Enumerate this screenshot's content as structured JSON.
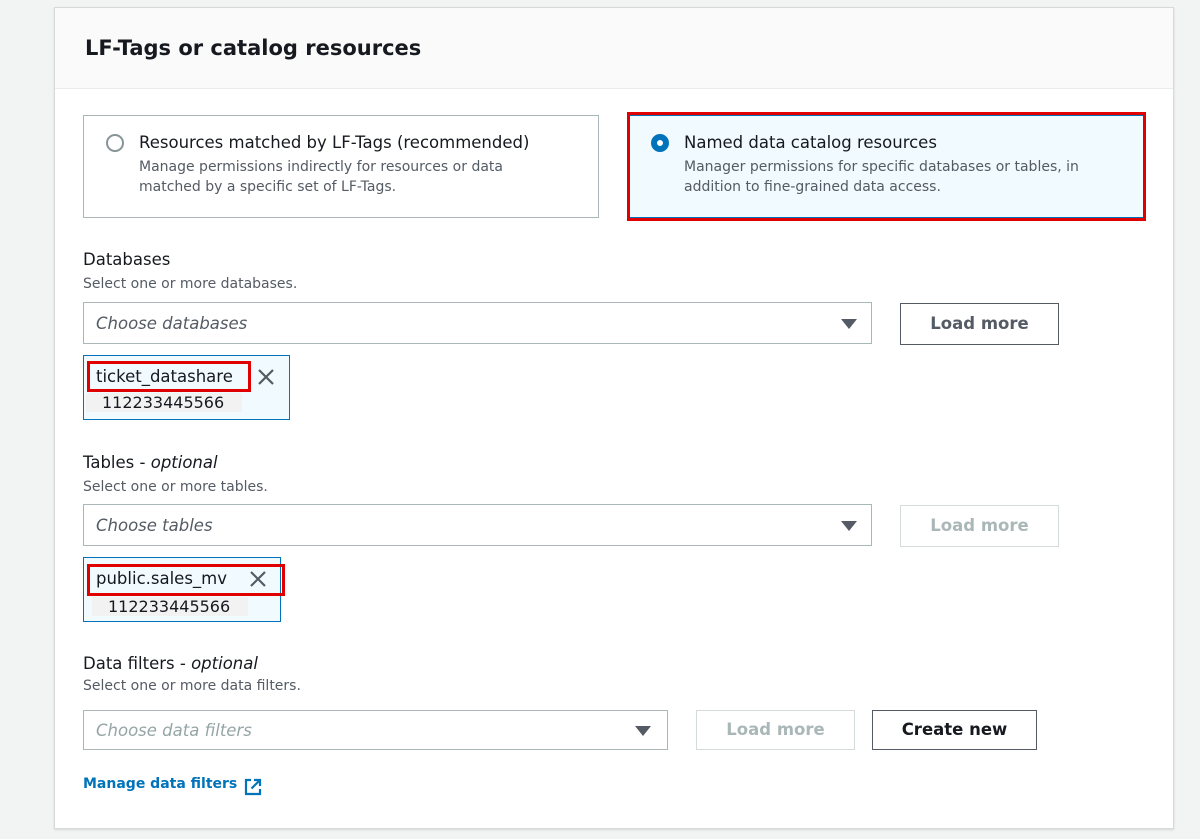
{
  "section": {
    "title": "LF-Tags or catalog resources"
  },
  "options": [
    {
      "title": "Resources matched by LF-Tags (recommended)",
      "desc_line1": "Manage permissions indirectly for resources or data",
      "desc_line2": "matched by a specific set of LF-Tags.",
      "selected": false
    },
    {
      "title": "Named data catalog resources",
      "desc_line1": "Manager permissions for specific databases or tables, in",
      "desc_line2": "addition to fine-grained data access.",
      "selected": true
    }
  ],
  "databases": {
    "label": "Databases",
    "description": "Select one or more databases.",
    "placeholder": "Choose databases",
    "load_more": "Load more",
    "selected": {
      "name": "ticket_datashare",
      "account": "112233445566"
    }
  },
  "tables": {
    "label": "Tables",
    "optional": "optional",
    "description": "Select one or more tables.",
    "placeholder": "Choose tables",
    "load_more": "Load more",
    "selected": {
      "name": "public.sales_mv",
      "account": "112233445566"
    }
  },
  "data_filters": {
    "label": "Data filters",
    "optional": "optional",
    "description": "Select one or more data filters.",
    "placeholder": "Choose data filters",
    "load_more": "Load more",
    "create_new": "Create new",
    "manage_link": "Manage data filters"
  },
  "colors": {
    "accent": "#0073bb",
    "highlight": "#e00000",
    "text": "#16191f",
    "muted": "#545b64"
  }
}
